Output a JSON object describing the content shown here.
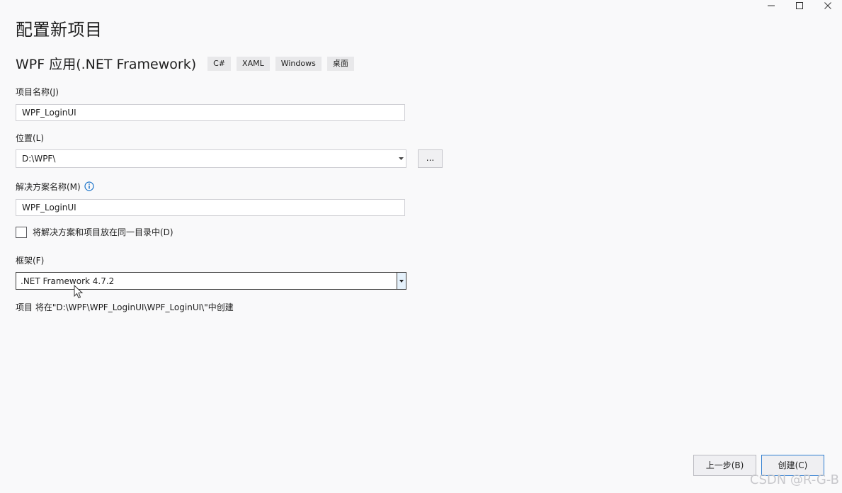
{
  "window": {
    "title": "配置新项目"
  },
  "template": {
    "name": "WPF 应用(.NET Framework)",
    "tags": [
      "C#",
      "XAML",
      "Windows",
      "桌面"
    ]
  },
  "form": {
    "project_name_label": "项目名称(J)",
    "project_name_value": "WPF_LoginUI",
    "location_label": "位置(L)",
    "location_value": "D:\\WPF\\",
    "browse_label": "...",
    "solution_name_label": "解决方案名称(M)",
    "solution_name_value": "WPF_LoginUI",
    "same_dir_label": "将解决方案和项目放在同一目录中(D)",
    "framework_label": "框架(F)",
    "framework_value": ".NET Framework 4.7.2",
    "location_info": "项目 将在\"D:\\WPF\\WPF_LoginUI\\WPF_LoginUI\\\"中创建"
  },
  "footer": {
    "back_label": "上一步(B)",
    "create_label": "创建(C)"
  },
  "watermark": "CSDN @R-G-B",
  "icons": {
    "minimize": "minimize-icon",
    "maximize": "maximize-icon",
    "close": "close-icon",
    "info": "info-icon",
    "dropdown": "chevron-down-icon",
    "cursor": "mouse-cursor-icon"
  },
  "colors": {
    "background": "#f9f9fa",
    "accent": "#2e7dd1",
    "tag_background": "#e8e8ea"
  }
}
